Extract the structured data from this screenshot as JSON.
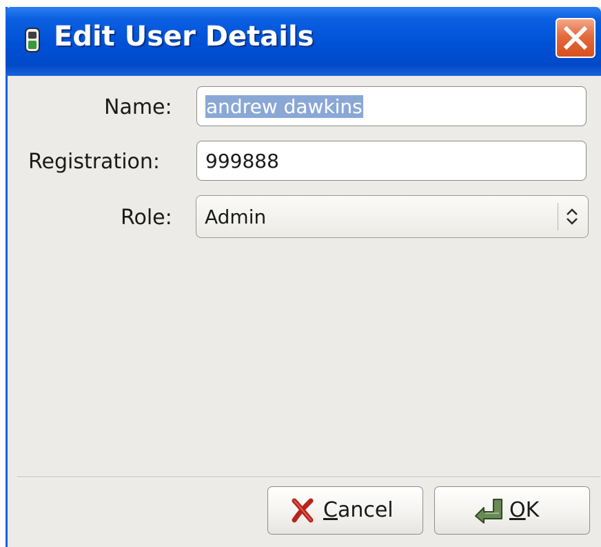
{
  "window": {
    "title": "Edit User Details",
    "title_icon": "padlock-icon",
    "close_icon": "close-icon"
  },
  "form": {
    "name": {
      "label": "Name:",
      "value": "andrew dawkins",
      "selected": true
    },
    "registration": {
      "label": "Registration:",
      "value": "999888"
    },
    "role": {
      "label": "Role:",
      "value": "Admin",
      "icon": "updown-arrows-icon"
    }
  },
  "buttons": {
    "cancel": {
      "mnemonic": "C",
      "rest": "ancel",
      "icon": "red-x-icon"
    },
    "ok": {
      "mnemonic": "O",
      "rest": "K",
      "icon": "green-arrow-icon"
    }
  },
  "colors": {
    "titlebar": "#0050d6",
    "dialog_bg": "#ecebe8",
    "close_button": "#e46a3d",
    "selection": "#8aa8d6"
  }
}
